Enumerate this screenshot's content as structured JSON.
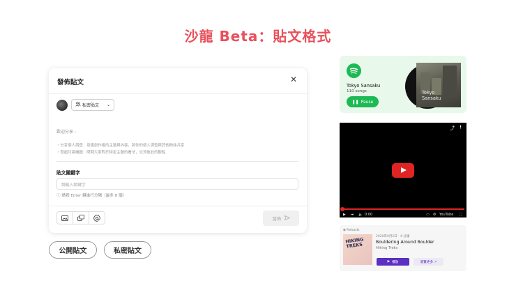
{
  "page": {
    "title": "沙龍 Beta：貼文格式"
  },
  "dialog": {
    "title": "發佈貼文",
    "close": "✕",
    "privacy": {
      "label": "私密貼文",
      "icon": "people-icon"
    },
    "placeholder": "歡迎分享⋯",
    "guidelines": [
      "・分享個人調查：尋邊創作者的主題與內容，將你的個人調查與其他粉絲共享",
      "・發起討論議題：問問大家對於特定主題的看法，交流彼此的觀點"
    ],
    "keywords": {
      "label": "貼文關鍵字",
      "placeholder": "請輸入關鍵字",
      "hint": "ⓘ 請按 Enter 鍵進行分隔（最多 8 個）"
    },
    "toolbar": {
      "icons": [
        "image-icon",
        "gallery-icon",
        "mention-icon"
      ]
    },
    "publish_label": "發佈"
  },
  "buttons": {
    "public": "公開貼文",
    "private": "私密貼文"
  },
  "spotify": {
    "title": "Tokyo Sansaku",
    "count": "110 songs",
    "pause_label": "Pause",
    "cover_title_line1": "Tokyo",
    "cover_title_line2": "Sansaku",
    "accent": "#1db954"
  },
  "video": {
    "time": "0:00",
    "logo": "YouTube"
  },
  "podcast": {
    "tag": "◉ Podcasts",
    "date": "2020年9月2日 · 4 分鐘",
    "title": "Bouldering Around Boulder",
    "show": "Hiking Treks",
    "cover_text_line1": "HIKING",
    "cover_text_line2": "TREKS",
    "play_label": "播放",
    "more_label": "瀏覽更多 ↗",
    "accent": "#5a2fc2"
  }
}
